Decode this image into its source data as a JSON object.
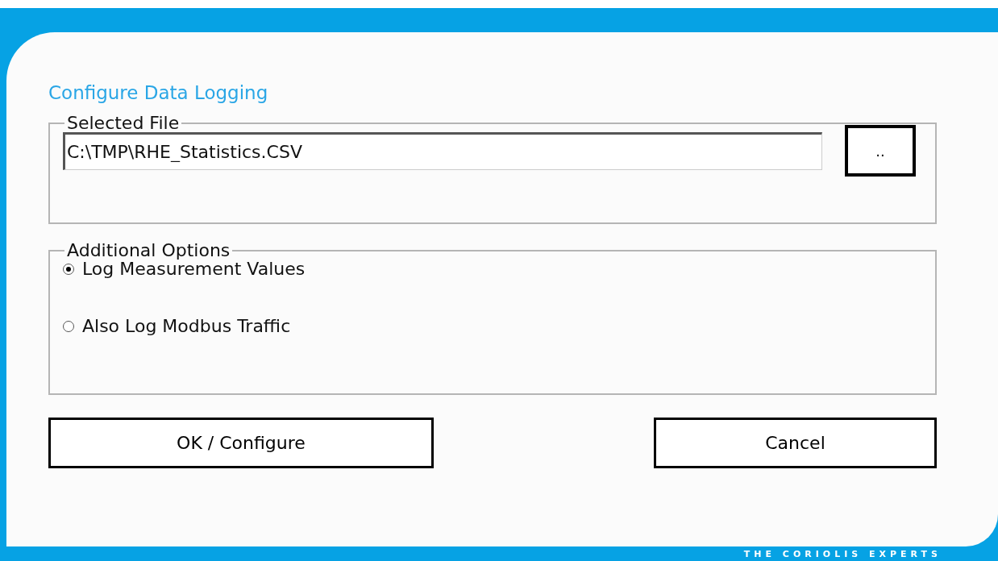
{
  "dialog": {
    "title": "Configure Data Logging"
  },
  "selected_file": {
    "legend": "Selected File",
    "value": "C:\\TMP\\RHE_Statistics.CSV",
    "browse_button": ".."
  },
  "additional_options": {
    "legend": "Additional Options",
    "options": [
      {
        "label": "Log Measurement Values",
        "selected": true
      },
      {
        "label": "Also Log Modbus Traffic",
        "selected": false
      }
    ]
  },
  "buttons": [
    "OK / Configure",
    "Cancel"
  ],
  "footer": {
    "tagline": "THE CORIOLIS EXPERTS"
  }
}
